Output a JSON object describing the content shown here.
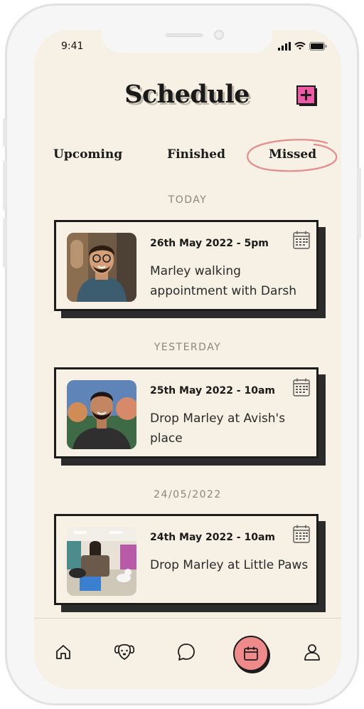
{
  "status_bar": {
    "time": "9:41"
  },
  "header": {
    "title": "Schedule"
  },
  "tabs": [
    {
      "label": "Upcoming"
    },
    {
      "label": "Finished"
    },
    {
      "label": "Missed"
    }
  ],
  "sections": [
    {
      "label": "TODAY",
      "card": {
        "date": "26th May 2022 - 5pm",
        "description": "Marley walking appointment with Darsh"
      }
    },
    {
      "label": "YESTERDAY",
      "card": {
        "date": "25th May 2022 - 10am",
        "description": "Drop Marley at Avish's place"
      }
    },
    {
      "label": "24/05/2022",
      "card": {
        "date": "24th May 2022 - 10am",
        "description": "Drop Marley at Little Paws"
      }
    }
  ],
  "bottom_nav": {
    "items": [
      "home-icon",
      "dog-icon",
      "chat-icon",
      "calendar-icon",
      "profile-icon"
    ],
    "active": "calendar-icon"
  },
  "colors": {
    "background": "#f6f1e4",
    "accent": "#ef8a8a",
    "add_button": "#ee5aa6",
    "ink": "#1c1c1c"
  }
}
